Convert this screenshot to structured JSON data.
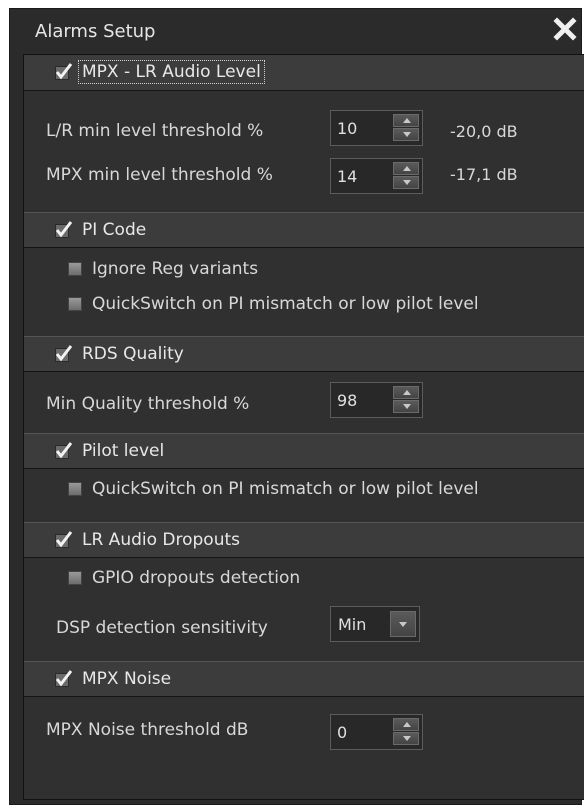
{
  "window": {
    "title": "Alarms Setup"
  },
  "sections": {
    "mpx_lr": {
      "label": "MPX - LR Audio Level"
    },
    "pi_code": {
      "label": "PI Code"
    },
    "rds_quality": {
      "label": "RDS Quality"
    },
    "pilot_level": {
      "label": "Pilot level"
    },
    "lr_dropouts": {
      "label": "LR Audio Dropouts"
    },
    "mpx_noise": {
      "label": "MPX Noise"
    }
  },
  "mpx_lr": {
    "lr_min_label": "L/R min level threshold %",
    "lr_min_value": "10",
    "lr_min_db": "-20,0 dB",
    "mpx_min_label": "MPX min level threshold %",
    "mpx_min_value": "14",
    "mpx_min_db": "-17,1 dB"
  },
  "pi_code": {
    "ignore_reg_label": "Ignore Reg variants",
    "quickswitch_label": "QuickSwitch on PI mismatch or low pilot level"
  },
  "rds_quality": {
    "min_quality_label": "Min Quality threshold %",
    "min_quality_value": "98"
  },
  "pilot_level": {
    "quickswitch_label": "QuickSwitch on PI mismatch or low pilot level"
  },
  "lr_dropouts": {
    "gpio_label": "GPIO dropouts detection",
    "dsp_label": "DSP detection sensitivity",
    "dsp_value": "Min"
  },
  "mpx_noise": {
    "threshold_label": "MPX Noise threshold dB",
    "threshold_value": "0"
  }
}
